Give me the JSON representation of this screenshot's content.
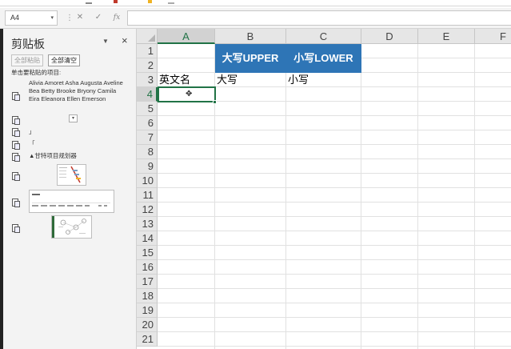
{
  "formula_bar": {
    "name_box": "A4",
    "cancel": "✕",
    "enter": "✓",
    "function": "fx",
    "formula": ""
  },
  "clipboard_pane": {
    "title": "剪贴板",
    "paste_all": "全部粘贴",
    "clear_all": "全部清空",
    "hint": "单击要粘贴的项目:",
    "items": [
      "Alivia Amoret Asha Augusta Aveline Bea Betty Brooke Bryony Camila Eira Eleanora Ellen Emerson",
      "",
      "」",
      "「",
      "▲甘特项目规划器",
      "",
      "",
      ""
    ]
  },
  "grid": {
    "columns": [
      "A",
      "B",
      "C",
      "D",
      "E",
      "F"
    ],
    "rows": [
      "1",
      "2",
      "3",
      "4",
      "5",
      "6",
      "7",
      "8",
      "9",
      "10",
      "11",
      "12",
      "13",
      "14",
      "15",
      "16",
      "17",
      "18",
      "19",
      "20",
      "21"
    ],
    "selected_cell": "A4",
    "cells": {
      "B1": "大写UPPER",
      "C1": "小写LOWER",
      "A3": "英文名",
      "B3": "大写",
      "C3": "小写"
    }
  },
  "colors": {
    "header_fill": "#2e75b6",
    "selection": "#217346"
  }
}
